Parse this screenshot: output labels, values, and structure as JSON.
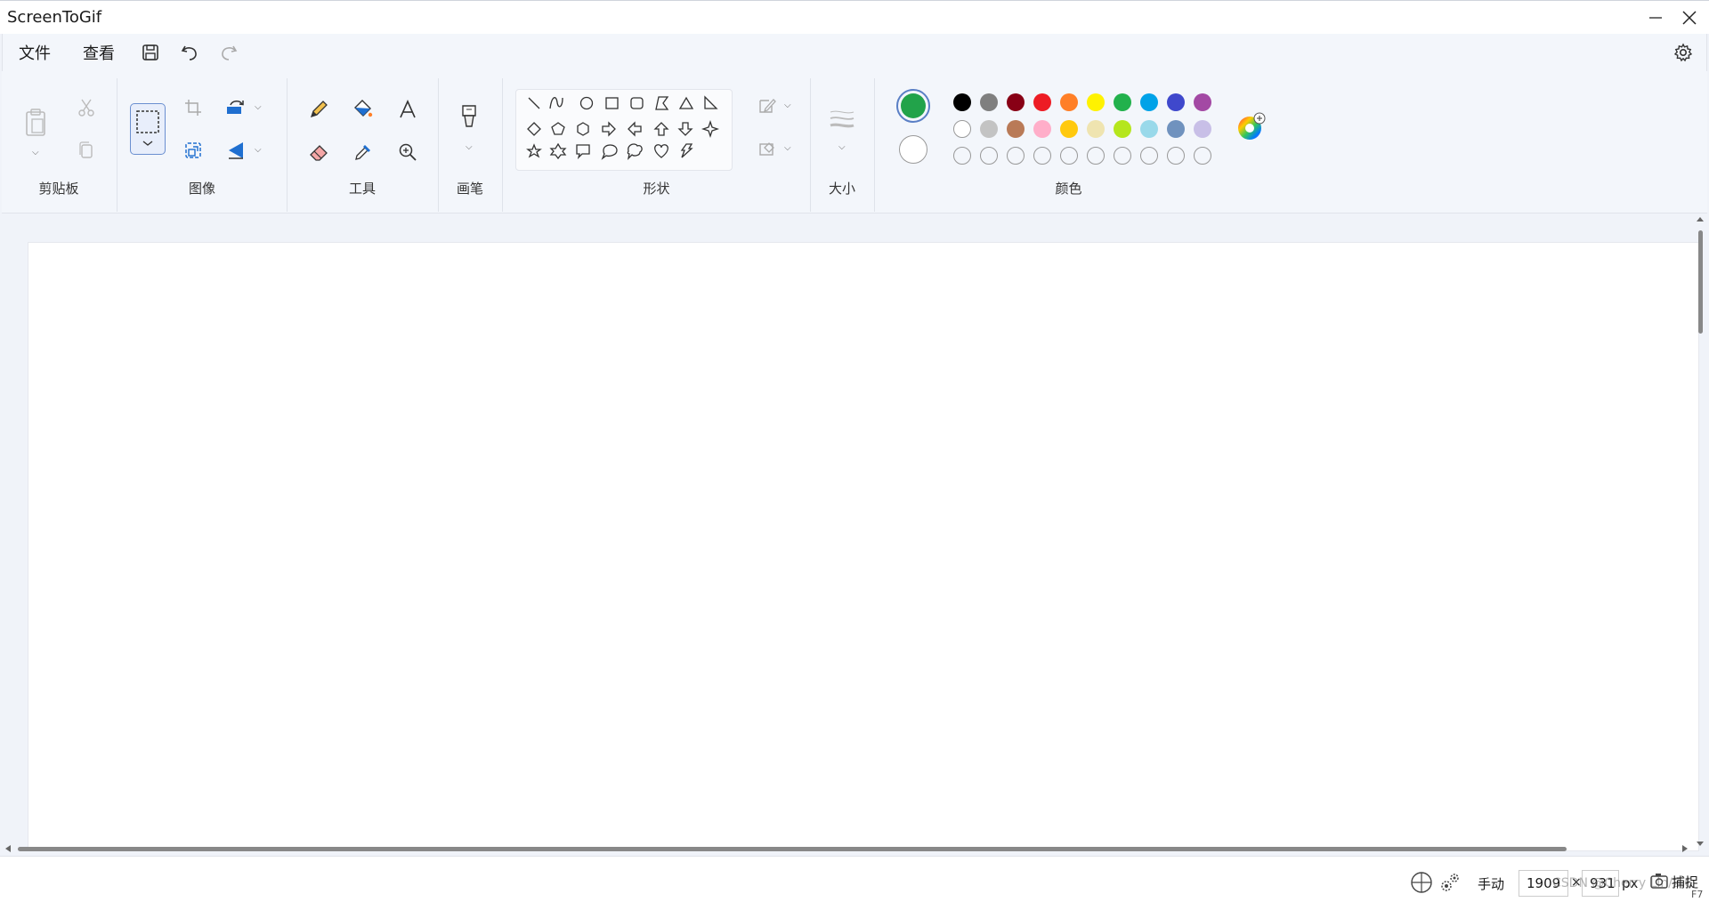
{
  "window": {
    "title": "ScreenToGif"
  },
  "menu": {
    "file": "文件",
    "view": "查看"
  },
  "ribbon": {
    "clipboard_label": "剪贴板",
    "image_label": "图像",
    "tools_label": "工具",
    "brush_label": "画笔",
    "shapes_label": "形状",
    "size_label": "大小",
    "colors_label": "颜色"
  },
  "colors": {
    "primary": "#22a34a",
    "secondary": "#ffffff",
    "palette_row1": [
      "#000000",
      "#7f7f7f",
      "#880015",
      "#ed1c24",
      "#ff7f27",
      "#fff200",
      "#22b14c",
      "#00a2e8",
      "#3f48cc",
      "#a349a4"
    ],
    "palette_row2": [
      "#ffffff",
      "#c3c3c3",
      "#b97a57",
      "#ffaec9",
      "#ffc90e",
      "#efe4b0",
      "#b5e61d",
      "#99d9ea",
      "#7092be",
      "#c8bfe7"
    ]
  },
  "status": {
    "mode": "手动",
    "width": "1909",
    "times": "×",
    "height": "931",
    "unit": "px",
    "capture": "捕捉",
    "watermark": "CSDN @Cherry Lin/2.6",
    "shortcut": "F7"
  }
}
